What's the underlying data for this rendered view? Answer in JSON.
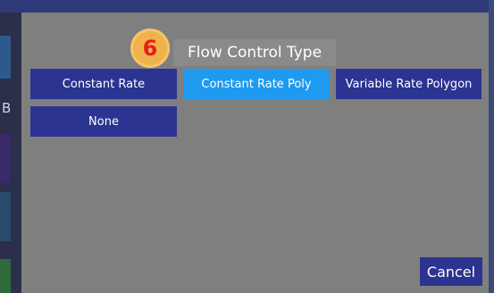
{
  "dialog": {
    "title": "Flow Control Type",
    "step_number": "6",
    "options": [
      {
        "label": "Constant Rate",
        "selected": false
      },
      {
        "label": "Constant Rate Poly",
        "selected": true
      },
      {
        "label": "Variable Rate Polygon",
        "selected": false
      },
      {
        "label": "None",
        "selected": false
      }
    ],
    "cancel_label": "Cancel"
  },
  "background": {
    "left_letter": "B"
  },
  "colors": {
    "dialog_bg": "#7f7f7f",
    "option_bg": "#2b3490",
    "option_selected_bg": "#1e9af0",
    "badge_bg": "#f0b24a",
    "badge_text": "#e41e1e"
  }
}
